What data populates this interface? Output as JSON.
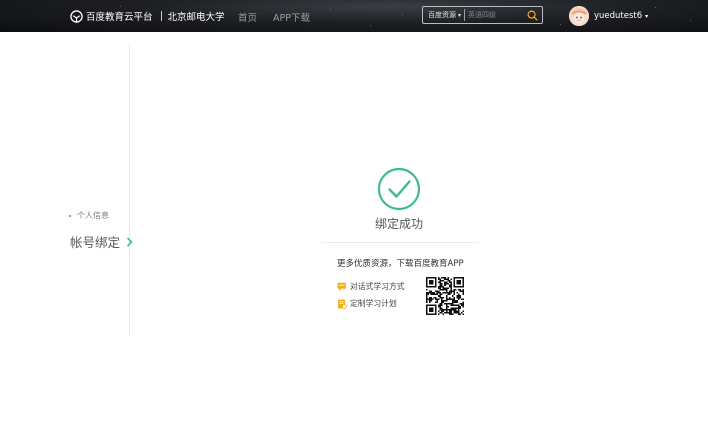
{
  "header": {
    "logo_text": "百度教育云平台",
    "school_name": "北京邮电大学",
    "nav": [
      {
        "label": "首页"
      },
      {
        "label": "APP下载"
      }
    ],
    "search": {
      "scope": "百度资源",
      "placeholder": "英语四级"
    },
    "user": {
      "username": "yuedutest6"
    }
  },
  "sidebar": {
    "personal_info": "个人信息",
    "account_binding": "帐号绑定"
  },
  "main": {
    "success_text": "绑定成功",
    "promo_text": "更多优质资源，下载百度教育APP",
    "features": [
      {
        "label": "对话式学习方式",
        "icon": "chat-icon"
      },
      {
        "label": "定制学习计划",
        "icon": "plan-icon"
      }
    ]
  },
  "colors": {
    "accent": "#3fba8f",
    "feature_icon": "#f2b01e",
    "header_bg": "#1d1f23"
  }
}
